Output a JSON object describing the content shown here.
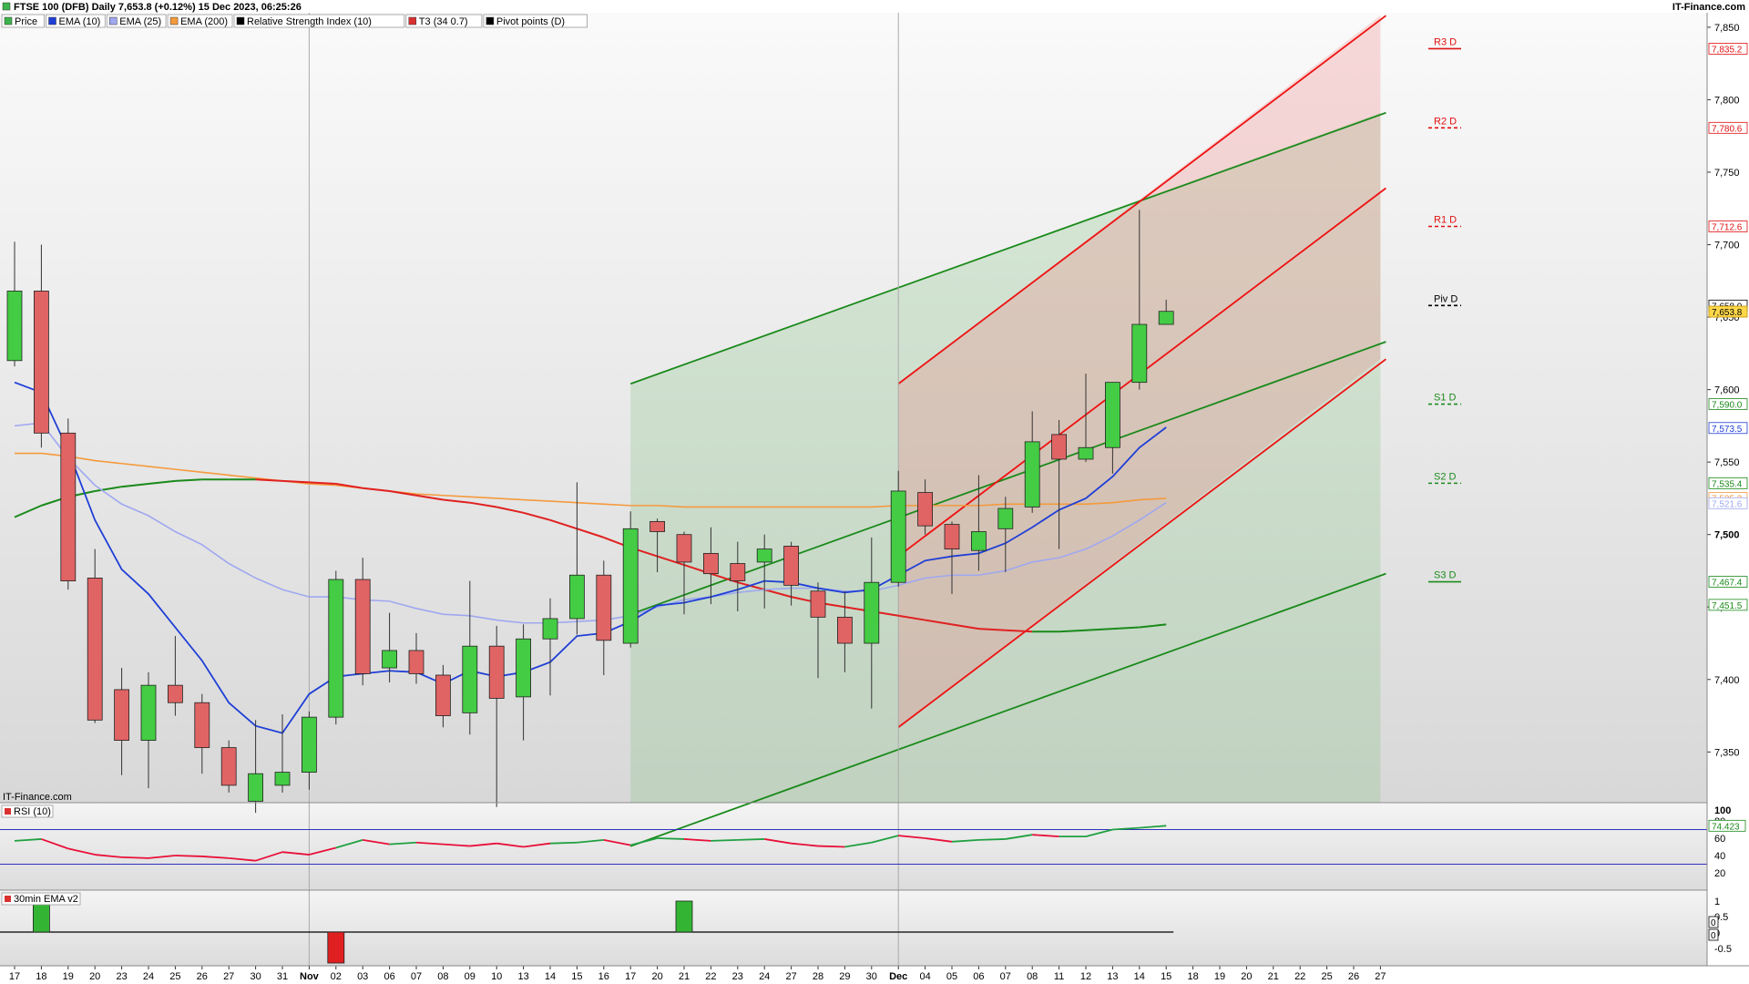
{
  "header": {
    "title": "FTSE 100 (DFB) Daily 7,653.8 (+0.12%) 15 Dec 2023, 06:25:26",
    "brand": "IT-Finance.com",
    "watermark": "IT-Finance.com"
  },
  "legend": [
    {
      "label": "Price",
      "color": "#3cb44b"
    },
    {
      "label": "EMA (10)",
      "color": "#1f3fd6"
    },
    {
      "label": "EMA (25)",
      "color": "#9fa8f0"
    },
    {
      "label": "EMA (200)",
      "color": "#f59a3c"
    },
    {
      "label": "Relative Strength Index (10)",
      "color": "#000000"
    },
    {
      "label": "T3 (34 0.7)",
      "color": "#d93030"
    },
    {
      "label": "Pivot points (D)",
      "color": "#000000"
    }
  ],
  "colors": {
    "up": "#44cc44",
    "down": "#e06464",
    "ema10": "#1f3fd6",
    "ema25": "#9fa8f0",
    "ema200": "#f59a3c",
    "t3": "#e02020",
    "rsi": "#e8103a",
    "rsi_up": "#20a040",
    "channel_green": "#1a8a1a",
    "channel_red": "#ee1111",
    "pivot_red": "#e01010",
    "pivot_green": "#1a8a1a"
  },
  "chart_data": [
    {
      "type": "candlestick",
      "title": "FTSE 100 (DFB) Daily",
      "x_labels": [
        "17",
        "18",
        "19",
        "20",
        "23",
        "24",
        "25",
        "26",
        "27",
        "30",
        "31",
        "Nov",
        "02",
        "03",
        "06",
        "07",
        "08",
        "09",
        "10",
        "13",
        "14",
        "15",
        "16",
        "17",
        "20",
        "21",
        "22",
        "23",
        "24",
        "27",
        "28",
        "29",
        "30",
        "Dec",
        "04",
        "05",
        "06",
        "07",
        "08",
        "11",
        "12",
        "13",
        "14",
        "15",
        "18",
        "19",
        "20",
        "21",
        "22",
        "25",
        "26",
        "27"
      ],
      "ohlc": [
        {
          "x": "17",
          "o": 7620,
          "h": 7702,
          "l": 7616,
          "c": 7668
        },
        {
          "x": "18",
          "o": 7668,
          "h": 7700,
          "l": 7560,
          "c": 7570
        },
        {
          "x": "19",
          "o": 7570,
          "h": 7580,
          "l": 7462,
          "c": 7468
        },
        {
          "x": "20",
          "o": 7470,
          "h": 7490,
          "l": 7370,
          "c": 7372
        },
        {
          "x": "23",
          "o": 7393,
          "h": 7408,
          "l": 7334,
          "c": 7358
        },
        {
          "x": "24",
          "o": 7358,
          "h": 7405,
          "l": 7325,
          "c": 7396
        },
        {
          "x": "25",
          "o": 7396,
          "h": 7430,
          "l": 7375,
          "c": 7384
        },
        {
          "x": "26",
          "o": 7384,
          "h": 7390,
          "l": 7335,
          "c": 7353
        },
        {
          "x": "27",
          "o": 7353,
          "h": 7358,
          "l": 7322,
          "c": 7327
        },
        {
          "x": "30",
          "o": 7316,
          "h": 7372,
          "l": 7308,
          "c": 7335
        },
        {
          "x": "31",
          "o": 7327,
          "h": 7376,
          "l": 7322,
          "c": 7336
        },
        {
          "x": "Nov",
          "o": 7336,
          "h": 7378,
          "l": 7324,
          "c": 7374
        },
        {
          "x": "02",
          "o": 7374,
          "h": 7475,
          "l": 7369,
          "c": 7469
        },
        {
          "x": "03",
          "o": 7469,
          "h": 7484,
          "l": 7396,
          "c": 7404
        },
        {
          "x": "06",
          "o": 7408,
          "h": 7446,
          "l": 7398,
          "c": 7420
        },
        {
          "x": "07",
          "o": 7420,
          "h": 7432,
          "l": 7397,
          "c": 7404
        },
        {
          "x": "08",
          "o": 7403,
          "h": 7410,
          "l": 7367,
          "c": 7375
        },
        {
          "x": "09",
          "o": 7377,
          "h": 7468,
          "l": 7362,
          "c": 7423
        },
        {
          "x": "10",
          "o": 7423,
          "h": 7437,
          "l": 7312,
          "c": 7387
        },
        {
          "x": "13",
          "o": 7388,
          "h": 7438,
          "l": 7358,
          "c": 7428
        },
        {
          "x": "14",
          "o": 7428,
          "h": 7456,
          "l": 7389,
          "c": 7442
        },
        {
          "x": "15",
          "o": 7442,
          "h": 7536,
          "l": 7431,
          "c": 7472
        },
        {
          "x": "16",
          "o": 7472,
          "h": 7482,
          "l": 7403,
          "c": 7427
        },
        {
          "x": "17",
          "o": 7425,
          "h": 7516,
          "l": 7422,
          "c": 7504
        },
        {
          "x": "20",
          "o": 7509,
          "h": 7511,
          "l": 7474,
          "c": 7502
        },
        {
          "x": "21",
          "o": 7500,
          "h": 7502,
          "l": 7445,
          "c": 7481
        },
        {
          "x": "22",
          "o": 7487,
          "h": 7505,
          "l": 7452,
          "c": 7473
        },
        {
          "x": "23",
          "o": 7480,
          "h": 7495,
          "l": 7447,
          "c": 7468
        },
        {
          "x": "24",
          "o": 7481,
          "h": 7500,
          "l": 7449,
          "c": 7490
        },
        {
          "x": "27",
          "o": 7492,
          "h": 7495,
          "l": 7451,
          "c": 7465
        },
        {
          "x": "28",
          "o": 7461,
          "h": 7467,
          "l": 7401,
          "c": 7443
        },
        {
          "x": "29",
          "o": 7443,
          "h": 7461,
          "l": 7405,
          "c": 7425
        },
        {
          "x": "30",
          "o": 7425,
          "h": 7498,
          "l": 7380,
          "c": 7467
        },
        {
          "x": "Dec",
          "o": 7467,
          "h": 7544,
          "l": 7464,
          "c": 7530
        },
        {
          "x": "04",
          "o": 7529,
          "h": 7538,
          "l": 7500,
          "c": 7506
        },
        {
          "x": "05",
          "o": 7507,
          "h": 7509,
          "l": 7459,
          "c": 7490
        },
        {
          "x": "06",
          "o": 7489,
          "h": 7541,
          "l": 7475,
          "c": 7502
        },
        {
          "x": "07",
          "o": 7504,
          "h": 7526,
          "l": 7474,
          "c": 7518
        },
        {
          "x": "08",
          "o": 7519,
          "h": 7585,
          "l": 7515,
          "c": 7564
        },
        {
          "x": "11",
          "o": 7569,
          "h": 7579,
          "l": 7490,
          "c": 7552
        },
        {
          "x": "12",
          "o": 7552,
          "h": 7611,
          "l": 7550,
          "c": 7560
        },
        {
          "x": "13",
          "o": 7560,
          "h": 7605,
          "l": 7542,
          "c": 7605
        },
        {
          "x": "14",
          "o": 7605,
          "h": 7724,
          "l": 7600,
          "c": 7645
        },
        {
          "x": "15",
          "o": 7645,
          "h": 7662,
          "l": 7645,
          "c": 7654
        }
      ],
      "ema10": [
        7605,
        7598,
        7558,
        7510,
        7476,
        7459,
        7436,
        7413,
        7384,
        7368,
        7363,
        7390,
        7402,
        7404,
        7406,
        7405,
        7397,
        7406,
        7402,
        7405,
        7412,
        7430,
        7432,
        7440,
        7451,
        7453,
        7457,
        7462,
        7468,
        7467,
        7463,
        7460,
        7462,
        7472,
        7482,
        7485,
        7487,
        7494,
        7505,
        7517,
        7525,
        7540,
        7560,
        7574
      ],
      "ema25": [
        7575,
        7577,
        7553,
        7534,
        7521,
        7513,
        7502,
        7493,
        7480,
        7470,
        7462,
        7457,
        7457,
        7455,
        7454,
        7449,
        7445,
        7444,
        7441,
        7439,
        7439,
        7440,
        7441,
        7444,
        7450,
        7455,
        7457,
        7460,
        7462,
        7463,
        7463,
        7461,
        7461,
        7465,
        7470,
        7472,
        7472,
        7475,
        7481,
        7484,
        7490,
        7499,
        7510,
        7522
      ],
      "ema200": [
        7556,
        7556,
        7554,
        7551,
        7549,
        7547,
        7545,
        7543,
        7541,
        7539,
        7537,
        7535,
        7534,
        7532,
        7530,
        7528,
        7527,
        7526,
        7525,
        7524,
        7523,
        7522,
        7521,
        7520,
        7520,
        7519,
        7519,
        7519,
        7519,
        7519,
        7519,
        7519,
        7519,
        7520,
        7520,
        7520,
        7520,
        7521,
        7521,
        7521,
        7521,
        7522,
        7524,
        7525
      ],
      "t3": [
        7512,
        7520,
        7526,
        7530,
        7533,
        7535,
        7537,
        7538,
        7538,
        7538,
        7537,
        7536,
        7535,
        7532,
        7530,
        7527,
        7524,
        7522,
        7519,
        7515,
        7510,
        7504,
        7498,
        7491,
        7485,
        7479,
        7473,
        7467,
        7462,
        7457,
        7453,
        7450,
        7447,
        7444,
        7441,
        7438,
        7435,
        7434,
        7433,
        7433,
        7434,
        7435,
        7436,
        7438
      ],
      "pivots": [
        {
          "label": "R3 D",
          "value": 7835.2
        },
        {
          "label": "R2 D",
          "value": 7780.6
        },
        {
          "label": "R1 D",
          "value": 7712.6
        },
        {
          "label": "Piv D",
          "value": 7658.0
        },
        {
          "label": "S1 D",
          "value": 7590.0
        },
        {
          "label": "S2 D",
          "value": 7535.4
        },
        {
          "label": "S3 D",
          "value": 7467.4
        }
      ],
      "right_badges": [
        {
          "value": "7,835.2",
          "series": "R3 D"
        },
        {
          "value": "7,780.6",
          "series": "R2 D"
        },
        {
          "value": "7,712.6",
          "series": "R1 D"
        },
        {
          "value": "7,658.0",
          "series": "Piv D"
        },
        {
          "value": "7,653.8",
          "series": "Price"
        },
        {
          "value": "7,590.0",
          "series": "S1 D"
        },
        {
          "value": "7,573.5",
          "series": "EMA (10)"
        },
        {
          "value": "7,535.4",
          "series": "S2 D"
        },
        {
          "value": "7,525.2",
          "series": "EMA (200)"
        },
        {
          "value": "7,521.6",
          "series": "EMA (25)"
        },
        {
          "value": "7,467.4",
          "series": "S3 D"
        },
        {
          "value": "7,451.5",
          "series": "T3 (34 0.7)"
        }
      ],
      "y_ticks": [
        "7,850",
        "7,800",
        "7,750",
        "7,700",
        "7,650",
        "7,600",
        "7,550",
        "7,500",
        "7,450",
        "7,400",
        "7,350"
      ],
      "ylim": [
        7315,
        7860
      ]
    },
    {
      "type": "line",
      "title": "RSI (10)",
      "values": [
        57,
        59,
        48,
        41,
        38,
        37,
        40,
        39,
        37,
        34,
        44,
        41,
        49,
        58,
        53,
        55,
        53,
        51,
        54,
        50,
        54,
        55,
        58,
        52,
        60,
        59,
        57,
        58,
        59,
        54,
        51,
        50,
        55,
        63,
        60,
        56,
        58,
        59,
        64,
        62,
        62,
        70,
        72,
        74.4
      ],
      "y_ticks": [
        "100",
        "80",
        "60",
        "40",
        "20"
      ],
      "upper_band": 70,
      "lower_band": 30,
      "ylim": [
        0,
        100
      ],
      "badge": "74.423"
    },
    {
      "type": "bar",
      "title": "30min EMA v2",
      "values": [
        {
          "x": "18",
          "v": 1
        },
        {
          "x": "02",
          "v": -1
        },
        {
          "x": "21",
          "v": 1
        }
      ],
      "y_ticks": [
        "1",
        "0.5",
        "0",
        "-0.5"
      ],
      "ylim": [
        -1,
        1
      ],
      "badges": [
        "0",
        "0"
      ]
    }
  ],
  "channels": [
    {
      "name": "green-channel-upper",
      "color": "#1a8a1a",
      "x_start": "17",
      "x_end": "27",
      "y_start": 7604,
      "y_end": 7791
    },
    {
      "name": "green-channel-lower",
      "color": "#1a8a1a",
      "x_start": "17",
      "x_end": "27",
      "y_start": 7285,
      "y_end": 7473
    },
    {
      "name": "green-channel-mid",
      "color": "#1a8a1a",
      "x_start": "17",
      "x_end": "27",
      "y_start": 7445,
      "y_end": 7633
    },
    {
      "name": "red-channel-upper",
      "color": "#ee1111",
      "x_start": "Dec",
      "x_end": "27",
      "y_start": 7604,
      "y_end": 7858
    },
    {
      "name": "red-channel-lower",
      "color": "#ee1111",
      "x_start": "Dec",
      "x_end": "27",
      "y_start": 7367,
      "y_end": 7621
    },
    {
      "name": "red-channel-mid",
      "color": "#ee1111",
      "x_start": "Dec",
      "x_end": "27",
      "y_start": 7485,
      "y_end": 7739
    }
  ]
}
